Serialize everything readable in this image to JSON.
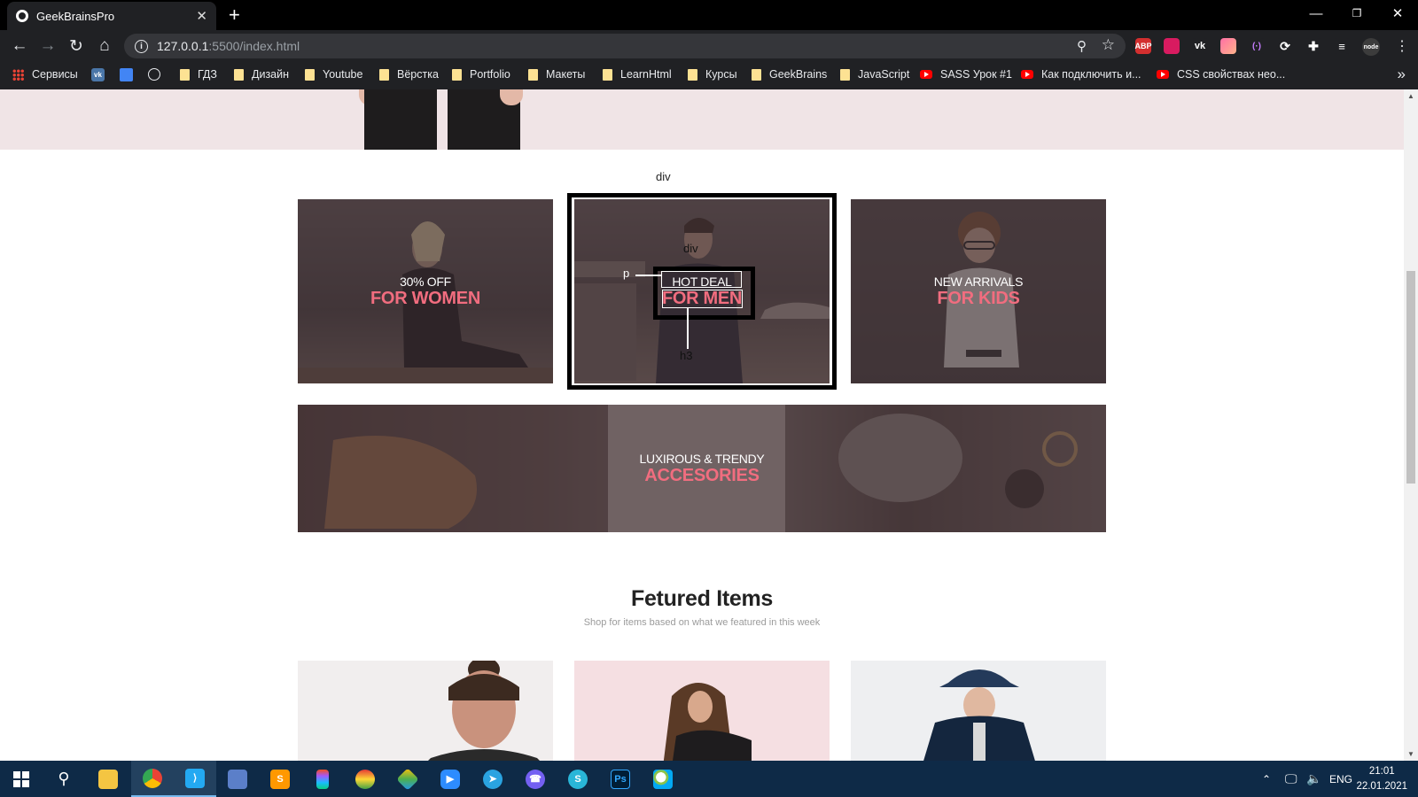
{
  "browser": {
    "tab_title": "GeekBrainsPro",
    "tab_close": "✕",
    "new_tab": "+",
    "url_host": "127.0.0.1",
    "url_path": ":5500/index.html",
    "window_controls": {
      "minimize": "—",
      "restore": "❐",
      "close": "✕"
    },
    "extensions": [
      "ABP",
      "",
      "vk",
      "",
      "(·)",
      "⟳",
      "",
      "",
      "node"
    ]
  },
  "bookmarks": [
    {
      "label": "Сервисы",
      "icon": "apps-icon"
    },
    {
      "label": "",
      "icon": "vk-icon"
    },
    {
      "label": "",
      "icon": "google-translate-icon"
    },
    {
      "label": "",
      "icon": "globe-icon"
    },
    {
      "label": "ГДЗ",
      "icon": "folder-icon"
    },
    {
      "label": "Дизайн",
      "icon": "folder-icon"
    },
    {
      "label": "Youtube",
      "icon": "folder-icon"
    },
    {
      "label": "Вёрстка",
      "icon": "folder-icon"
    },
    {
      "label": "Portfolio",
      "icon": "folder-icon"
    },
    {
      "label": "Макеты",
      "icon": "folder-icon"
    },
    {
      "label": "LearnHtml",
      "icon": "folder-icon"
    },
    {
      "label": "Курсы",
      "icon": "folder-icon"
    },
    {
      "label": "GeekBrains",
      "icon": "folder-icon"
    },
    {
      "label": "JavaScript",
      "icon": "folder-icon"
    },
    {
      "label": "SASS Урок #1",
      "icon": "youtube-icon"
    },
    {
      "label": "Как подключить и...",
      "icon": "youtube-icon"
    },
    {
      "label": "CSS свойствах нео...",
      "icon": "youtube-icon"
    }
  ],
  "devtools": {
    "div_outer": "div",
    "div_inner": "div",
    "p_label": "p",
    "h3_label": "h3"
  },
  "banners": {
    "women": {
      "sub": "30% OFF",
      "title": "FOR WOMEN"
    },
    "men": {
      "sub": "HOT DEAL",
      "title": "FOR MEN"
    },
    "kids": {
      "sub": "NEW ARRIVALS",
      "title": "FOR KIDS"
    },
    "accessories": {
      "sub": "LUXIROUS & TRENDY",
      "title": "ACCESORIES"
    }
  },
  "featured": {
    "title": "Fetured Items",
    "subtitle": "Shop for items based on what we featured in this week"
  },
  "taskbar": {
    "apps": [
      "start",
      "search",
      "explorer",
      "chrome",
      "vscode",
      "save",
      "sublime",
      "figma",
      "colors",
      "git",
      "zoom",
      "telegram",
      "viber",
      "skype",
      "photoshop",
      "paint"
    ],
    "lang": "ENG",
    "time": "21:01",
    "date": "22.01.2021"
  },
  "colors": {
    "accent_pink": "#f16d7f",
    "chrome_dark": "#202124",
    "taskbar": "#0e2a47"
  }
}
